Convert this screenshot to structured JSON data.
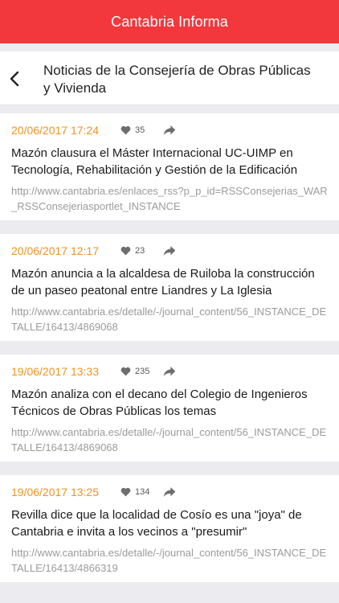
{
  "app": {
    "title": "Cantabria Informa",
    "accent_color": "#f2383c"
  },
  "header": {
    "back_icon": "chevron-left-icon",
    "title": "Noticias de la Consejería de Obras Públicas y Vivienda"
  },
  "icons": {
    "likes": "heart-icon",
    "share": "share-arrow-icon"
  },
  "colors": {
    "date": "#f0931f",
    "url": "#9b9b9b"
  },
  "news": [
    {
      "date": "20/06/2017 17:24",
      "likes": "35",
      "title": "Mazón clausura el Máster Internacional UC-UIMP en Tecnología, Rehabilitación y Gestión de la Edificación",
      "url": "http://www.cantabria.es/enlaces_rss?p_p_id=RSSConsejerias_WAR_RSSConsejeriasportlet_INSTANCE"
    },
    {
      "date": "20/06/2017 12:17",
      "likes": "23",
      "title": "Mazón anuncia a la alcaldesa de Ruiloba la construcción de un paseo peatonal entre Liandres y La Iglesia",
      "url": "http://www.cantabria.es/detalle/-/journal_content/56_INSTANCE_DETALLE/16413/4869068"
    },
    {
      "date": "19/06/2017 13:33",
      "likes": "235",
      "title": "Mazón analiza con el decano del Colegio de Ingenieros Técnicos de Obras Públicas los temas",
      "url": "http://www.cantabria.es/detalle/-/journal_content/56_INSTANCE_DETALLE/16413/4869068"
    },
    {
      "date": "19/06/2017 13:25",
      "likes": "134",
      "title": "Revilla dice que la localidad de Cosío es una \"joya\" de Cantabria e invita a los vecinos a \"presumir\"",
      "url": "http://www.cantabria.es/detalle/-/journal_content/56_INSTANCE_DETALLE/16413/4866319"
    }
  ]
}
